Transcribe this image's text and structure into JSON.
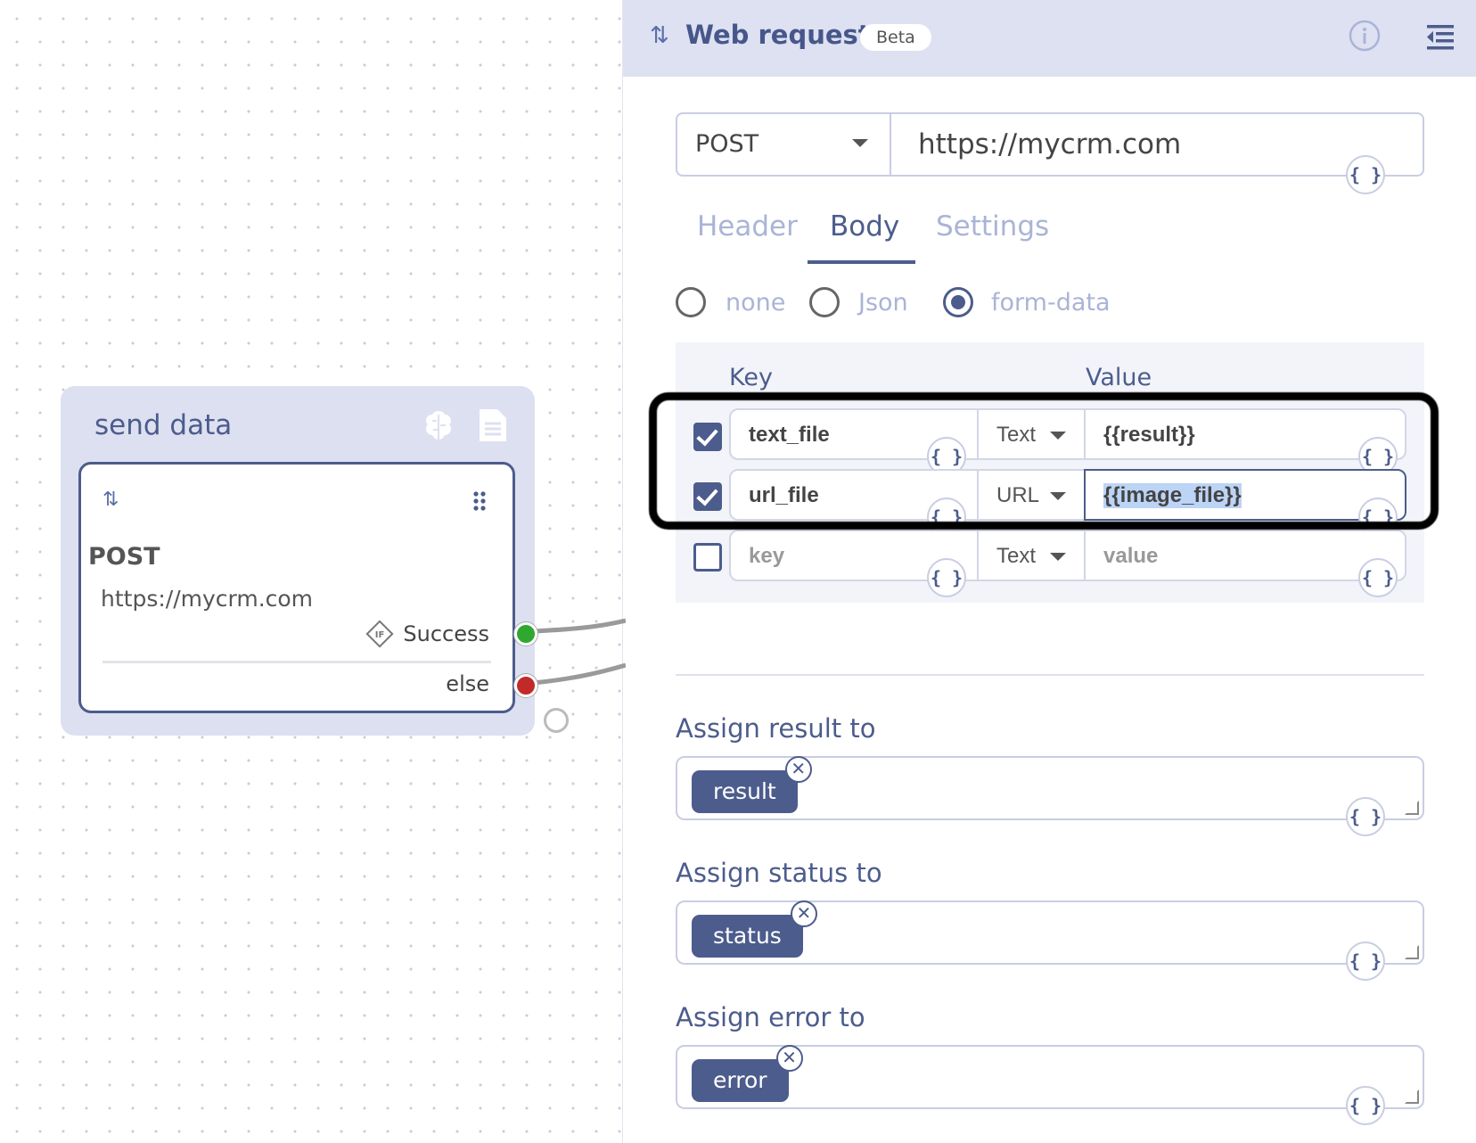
{
  "node": {
    "title": "send data",
    "method": "POST",
    "url": "https://mycrm.com",
    "success_label": "Success",
    "if_label": "IF",
    "else_label": "else"
  },
  "panel": {
    "arrows_glyph": "⇅",
    "title": "Web request",
    "badge": "Beta",
    "method": "POST",
    "url": "https://mycrm.com",
    "brace_glyph": "{ }",
    "tabs": [
      {
        "label": "Header",
        "active": false
      },
      {
        "label": "Body",
        "active": true
      },
      {
        "label": "Settings",
        "active": false
      }
    ],
    "body_types": [
      {
        "label": "none",
        "selected": false
      },
      {
        "label": "Json",
        "selected": false
      },
      {
        "label": "form-data",
        "selected": true
      }
    ],
    "kv_header": {
      "key": "Key",
      "value": "Value"
    },
    "rows": [
      {
        "checked": true,
        "key": "text_file",
        "type": "Text",
        "value": "{{result}}"
      },
      {
        "checked": true,
        "key": "url_file",
        "type": "URL",
        "value": "{{image_file}}"
      },
      {
        "checked": false,
        "key": "key",
        "type": "Text",
        "value": "value"
      }
    ],
    "assign": [
      {
        "label": "Assign result to",
        "chip": "result"
      },
      {
        "label": "Assign status to",
        "chip": "status"
      },
      {
        "label": "Assign error to",
        "chip": "error"
      }
    ],
    "chip_close_glyph": "✕"
  },
  "colors": {
    "accent": "#4c5c8c",
    "header_bg": "#dde1f2",
    "success": "#2fa82f",
    "error": "#c22a2a"
  }
}
